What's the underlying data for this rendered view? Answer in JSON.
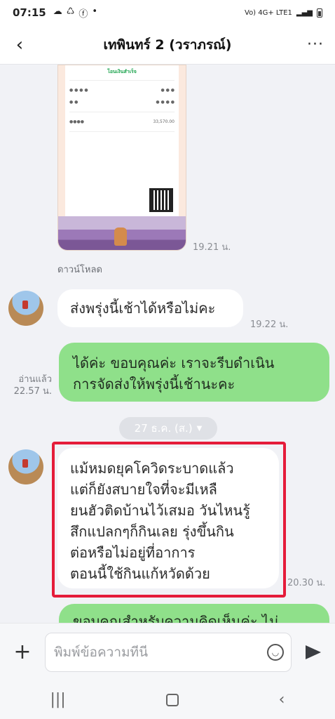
{
  "status_bar": {
    "time": "07:15",
    "left_icons": [
      "cloud-icon",
      "recycle-icon",
      "facebook-icon",
      "dot-icon"
    ],
    "network_label": "Vo) 4G+ LTE1",
    "battery_icon": "battery-icon"
  },
  "header": {
    "back_icon": "back-chevron-icon",
    "title": "เทพินทร์ 2 (วราภรณ์)",
    "more_icon": "more-dots-icon"
  },
  "messages": {
    "receipt_image": {
      "status": "โอนเงินสำเร็จ",
      "amount": "33,570.00",
      "time": "19.21 น."
    },
    "download_label": "ดาวน์โหลด",
    "msg1": {
      "text": "ส่งพรุ่งนี้เช้าได้หรือไม่คะ",
      "time": "19.22 น."
    },
    "msg2": {
      "lines": [
        "ได้ค่ะ ขอบคุณค่ะ เราจะรีบดำเนิน",
        "การจัดส่งให้พรุ่งนี้เช้านะคะ"
      ],
      "read_label": "อ่านแล้ว",
      "time": "22.57 น."
    },
    "date_separator": "27 ธ.ค. (ส.)",
    "msg3": {
      "lines": [
        "แม้หมดยุคโควิดระบาดแล้ว",
        "แต่ก็ยังสบายใจที่จะมีเหลื",
        "ยนฮัวติดบ้านไว้เสมอ วันไหนรู้",
        "สึกแปลกๆก็กินเลย รุ่งขึ้นกิน",
        "ต่อหรือไม่อยู่ที่อาการ",
        "ตอนนี้ใช้กินแก้หวัดด้วย"
      ],
      "time": "20.30 น."
    },
    "msg4_partial": "ขอบคุณสำหรับความคิดเห็นค่ะ ไม่"
  },
  "input_bar": {
    "plus_icon": "plus-icon",
    "placeholder": "พิมพ์ข้อความที่นี่",
    "emoji_icon": "emoji-icon",
    "send_icon": "send-icon"
  },
  "colors": {
    "outgoing_bubble": "#8fe08a",
    "incoming_bubble": "#ffffff",
    "highlight": "#e51c3a",
    "background": "#f1f2f6"
  }
}
